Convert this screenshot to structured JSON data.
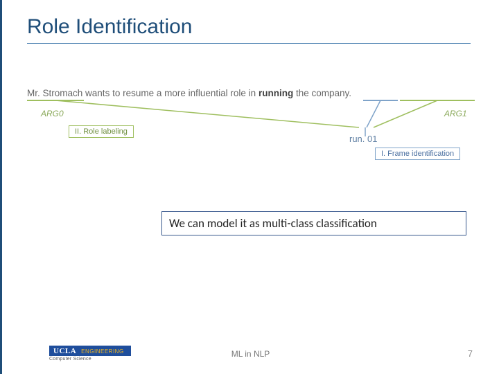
{
  "title": "Role Identification",
  "sentence": {
    "tokens": [
      "Mr. Stromach",
      "wants to resume",
      "a more influential role in",
      "running",
      "the company."
    ],
    "predicate_index": 3
  },
  "args": {
    "arg0": "ARG0",
    "arg1": "ARG1"
  },
  "frame": "run. 01",
  "pills": {
    "role_labeling": "II. Role labeling",
    "frame_identification": "I. Frame identification"
  },
  "callout": "We can model it as multi-class classification",
  "footer": {
    "center": "ML in NLP",
    "page": "7",
    "logo_top": "UCLA",
    "logo_eng": "ENGINEERING",
    "logo_sub": "Computer Science"
  },
  "colors": {
    "accent_blue": "#1f4e79",
    "arg_green": "#8aa95a",
    "frame_blue": "#5f7fa3"
  }
}
